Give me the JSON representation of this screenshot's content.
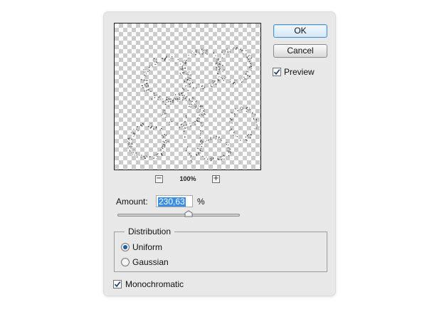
{
  "dialog": {
    "buttons": {
      "ok_label": "OK",
      "cancel_label": "Cancel"
    },
    "preview_checkbox": {
      "label": "Preview",
      "checked": true
    },
    "zoom": {
      "level": "100%",
      "minus": "−",
      "plus": "+"
    },
    "amount": {
      "label": "Amount:",
      "value": "230,63",
      "unit": "%",
      "slider_fraction": 0.58
    },
    "distribution": {
      "title": "Distribution",
      "options": [
        {
          "label": "Uniform",
          "selected": true
        },
        {
          "label": "Gaussian",
          "selected": false
        }
      ]
    },
    "monochromatic": {
      "label": "Monochromatic",
      "checked": true
    }
  },
  "icons": {
    "checkmark": "check-icon",
    "zoom_out": "minus-icon",
    "zoom_in": "plus-icon"
  },
  "colors": {
    "accent": "#3a8ee6",
    "ok_border": "#4a92c8",
    "radio_dot": "#1f5f9a",
    "checker": "#cbcbcb"
  }
}
